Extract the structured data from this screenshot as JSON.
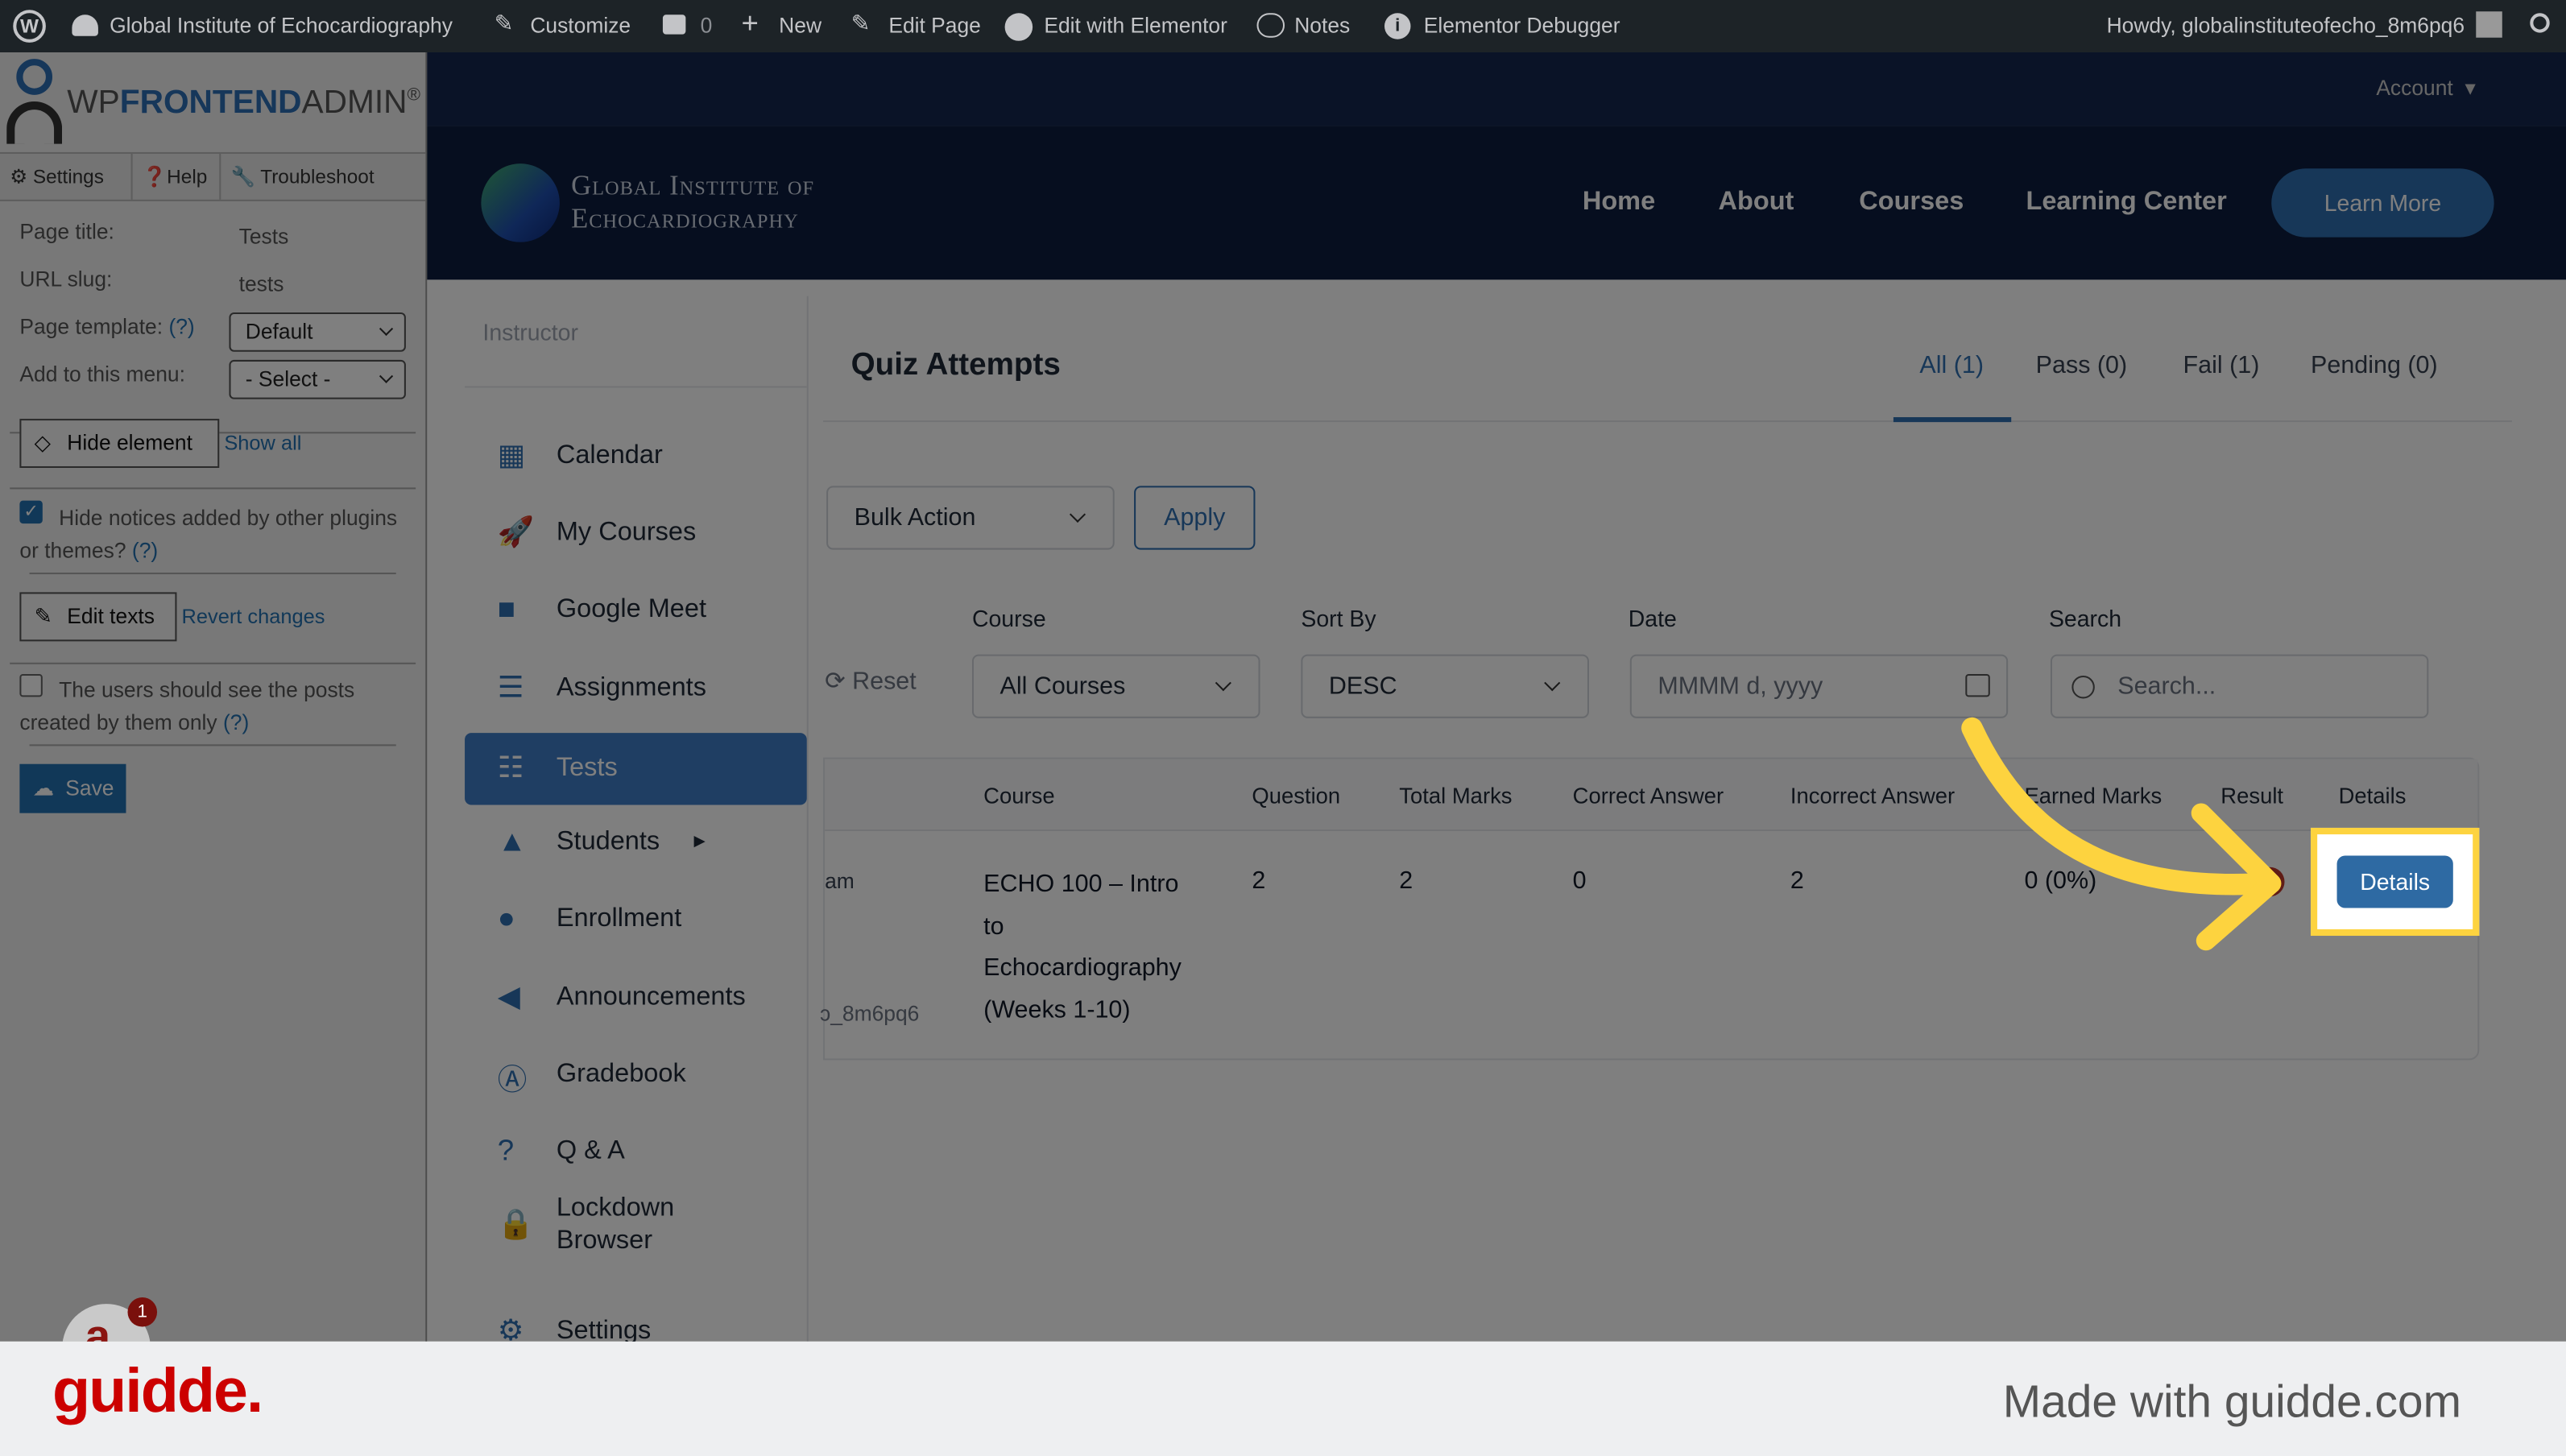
{
  "adminbar": {
    "site_name": "Global Institute of Echocardiography",
    "customize": "Customize",
    "comments": "0",
    "new": "New",
    "edit_page": "Edit Page",
    "edit_elementor": "Edit with Elementor",
    "notes": "Notes",
    "debugger": "Elementor Debugger",
    "howdy": "Howdy, globalinstituteofecho_8m6pq6"
  },
  "frontend_admin": {
    "logo_wp": "WP",
    "logo_frontend": "FRONTEND",
    "logo_admin": "ADMIN",
    "logo_reg": "®",
    "tabs": [
      "Settings",
      "Help",
      "Troubleshoot"
    ],
    "page_title_label": "Page title:",
    "page_title_value": "Tests",
    "url_slug_label": "URL slug:",
    "url_slug_value": "tests",
    "template_label": "Page template:",
    "template_help": "(?)",
    "template_value": "Default",
    "menu_label": "Add to this menu:",
    "menu_value": "- Select -",
    "hide_element": "Hide element",
    "show_all": "Show all",
    "hide_notices": "Hide notices added by other plugins or themes?",
    "hide_notices_checked": true,
    "help": "(?)",
    "edit_texts": "Edit texts",
    "revert": "Revert changes",
    "own_posts": "The users should see the posts created by them only",
    "own_posts_checked": false,
    "save": "Save"
  },
  "site": {
    "account": "Account",
    "logo_line1": "Global Institute of",
    "logo_line2": "Echocardiography",
    "nav": [
      "Home",
      "About",
      "Courses",
      "Learning Center"
    ],
    "cta": "Learn More",
    "cta_color": "#2f6fb0"
  },
  "sidebar": {
    "heading": "Instructor",
    "items": [
      {
        "label": "Calendar",
        "icon": "calendar-icon"
      },
      {
        "label": "My Courses",
        "icon": "rocket-icon"
      },
      {
        "label": "Google Meet",
        "icon": "video-camera-icon"
      },
      {
        "label": "Assignments",
        "icon": "checklist-icon"
      },
      {
        "label": "Tests",
        "icon": "quiz-icon",
        "active": true
      },
      {
        "label": "Students",
        "icon": "graduation-cap-icon"
      },
      {
        "label": "Enrollment",
        "icon": "user-icon"
      },
      {
        "label": "Announcements",
        "icon": "megaphone-icon"
      },
      {
        "label": "Gradebook",
        "icon": "grade-icon"
      },
      {
        "label": "Q & A",
        "icon": "question-person-icon"
      },
      {
        "label": "Lockdown Browser",
        "icon": "lock-icon"
      },
      {
        "label": "Settings",
        "icon": "gear-icon"
      }
    ]
  },
  "main": {
    "title": "Quiz Attempts",
    "tabs": [
      "All (1)",
      "Pass (0)",
      "Fail (1)",
      "Pending (0)"
    ],
    "active_tab": "All (1)",
    "bulk_action": "Bulk Action",
    "apply": "Apply",
    "reset": "Reset",
    "filters": {
      "course_label": "Course",
      "course_value": "All Courses",
      "sort_label": "Sort By",
      "sort_value": "DESC",
      "date_label": "Date",
      "date_placeholder": "MMMM d, yyyy",
      "search_label": "Search",
      "search_placeholder": "Search..."
    },
    "table": {
      "headers": [
        "Course",
        "Question",
        "Total Marks",
        "Correct Answer",
        "Incorrect Answer",
        "Earned Marks",
        "Result",
        "Details"
      ],
      "rows": [
        {
          "partial_left_top": "am",
          "partial_left_bottom": "ɔ_8m6pq6",
          "course": [
            "ECHO 100 – Intro",
            "to",
            "Echocardiography",
            "(Weeks 1-10)"
          ],
          "question": "2",
          "total_marks": "2",
          "correct": "0",
          "incorrect": "2",
          "earned": "0 (0%)",
          "details": "Details"
        }
      ]
    }
  },
  "chat_badge": "1",
  "footer": {
    "brand": "guidde.",
    "made_with": "Made with guidde.com",
    "brand_color": "#cc0000"
  },
  "colors": {
    "highlight": "#fdd33f",
    "accent": "#2e6aa3"
  }
}
